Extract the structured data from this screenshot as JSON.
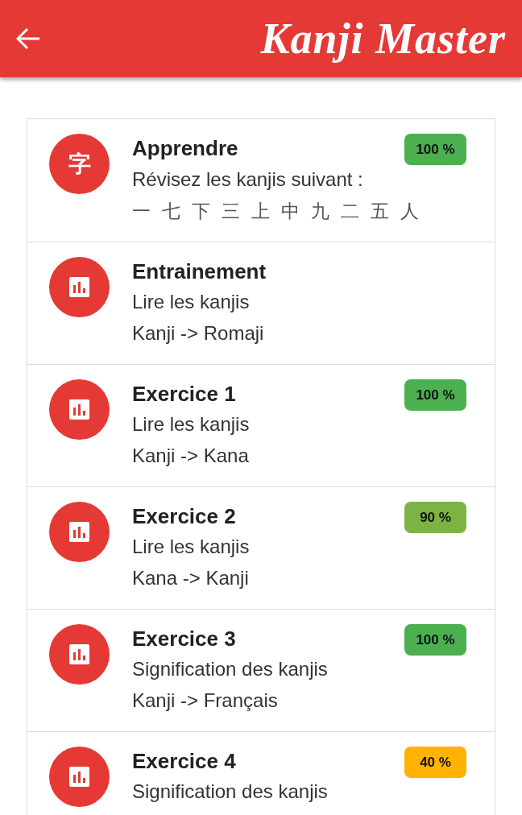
{
  "app_bar": {
    "title": "Kanji Master"
  },
  "lessons": [
    {
      "kind": "learn",
      "title": "Apprendre",
      "icon_glyph": "字",
      "score": "100 %",
      "color": "#4caf50",
      "description": "Révisez les kanjis suivant :",
      "kanjis": [
        "一",
        "七",
        "下",
        "三",
        "上",
        "中",
        "九",
        "二",
        "五",
        "人"
      ]
    },
    {
      "kind": "exercise",
      "title": "Entrainement",
      "lines": [
        "Lire les kanjis",
        "Kanji -> Romaji"
      ]
    },
    {
      "kind": "exercise",
      "title": "Exercice 1",
      "score": "100 %",
      "color": "#4caf50",
      "lines": [
        "Lire les kanjis",
        "Kanji -> Kana"
      ]
    },
    {
      "kind": "exercise",
      "title": "Exercice 2",
      "score": "90 %",
      "color": "#7cb342",
      "lines": [
        "Lire les kanjis",
        "Kana -> Kanji"
      ]
    },
    {
      "kind": "exercise",
      "title": "Exercice 3",
      "score": "100 %",
      "color": "#4caf50",
      "lines": [
        "Signification des kanjis",
        "Kanji -> Français"
      ]
    },
    {
      "kind": "exercise",
      "title": "Exercice 4",
      "score": "40 %",
      "color": "#ffb300",
      "lines": [
        "Signification des kanjis"
      ]
    }
  ]
}
